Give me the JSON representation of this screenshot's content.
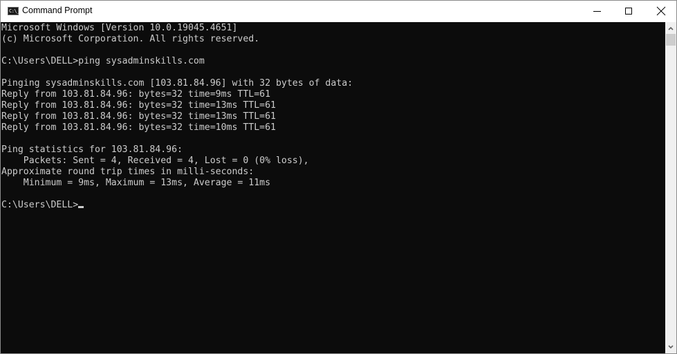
{
  "window": {
    "title": "Command Prompt",
    "app_icon_label": "C:\\_",
    "controls": {
      "minimize": "minimize",
      "maximize": "maximize",
      "close": "close"
    }
  },
  "console": {
    "lines": [
      "Microsoft Windows [Version 10.0.19045.4651]",
      "(c) Microsoft Corporation. All rights reserved.",
      "",
      "C:\\Users\\DELL>ping sysadminskills.com",
      "",
      "Pinging sysadminskills.com [103.81.84.96] with 32 bytes of data:",
      "Reply from 103.81.84.96: bytes=32 time=9ms TTL=61",
      "Reply from 103.81.84.96: bytes=32 time=13ms TTL=61",
      "Reply from 103.81.84.96: bytes=32 time=13ms TTL=61",
      "Reply from 103.81.84.96: bytes=32 time=10ms TTL=61",
      "",
      "Ping statistics for 103.81.84.96:",
      "    Packets: Sent = 4, Received = 4, Lost = 0 (0% loss),",
      "Approximate round trip times in milli-seconds:",
      "    Minimum = 9ms, Maximum = 13ms, Average = 11ms",
      ""
    ],
    "prompt": "C:\\Users\\DELL>",
    "colors": {
      "background": "#0c0c0c",
      "foreground": "#cccccc"
    }
  }
}
